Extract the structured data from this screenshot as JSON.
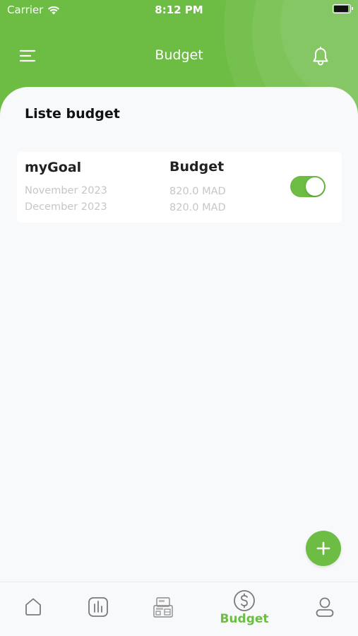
{
  "status_bar": {
    "carrier": "Carrier",
    "time": "8:12 PM"
  },
  "header": {
    "title": "Budget",
    "menu_icon": "menu-icon",
    "notification_icon": "bell-icon"
  },
  "section": {
    "title": "Liste budget"
  },
  "budgets": [
    {
      "name": "myGoal",
      "start": "November 2023",
      "end": "December 2023",
      "label": "Budget",
      "amount_start": "820.0 MAD",
      "amount_end": "820.0 MAD",
      "enabled": true
    }
  ],
  "fab": {
    "icon": "plus-icon"
  },
  "bottom_nav": {
    "items": [
      {
        "icon": "home-icon",
        "label": ""
      },
      {
        "icon": "stats-icon",
        "label": ""
      },
      {
        "icon": "transactions-icon",
        "label": ""
      },
      {
        "icon": "dollar-icon",
        "label": "Budget",
        "active": true
      },
      {
        "icon": "profile-icon",
        "label": ""
      }
    ]
  },
  "colors": {
    "primary": "#6dbd45",
    "background": "#f8f9fb",
    "text": "#222222",
    "muted": "#c6c6c6",
    "inactive_icon": "#7a7a7a"
  }
}
